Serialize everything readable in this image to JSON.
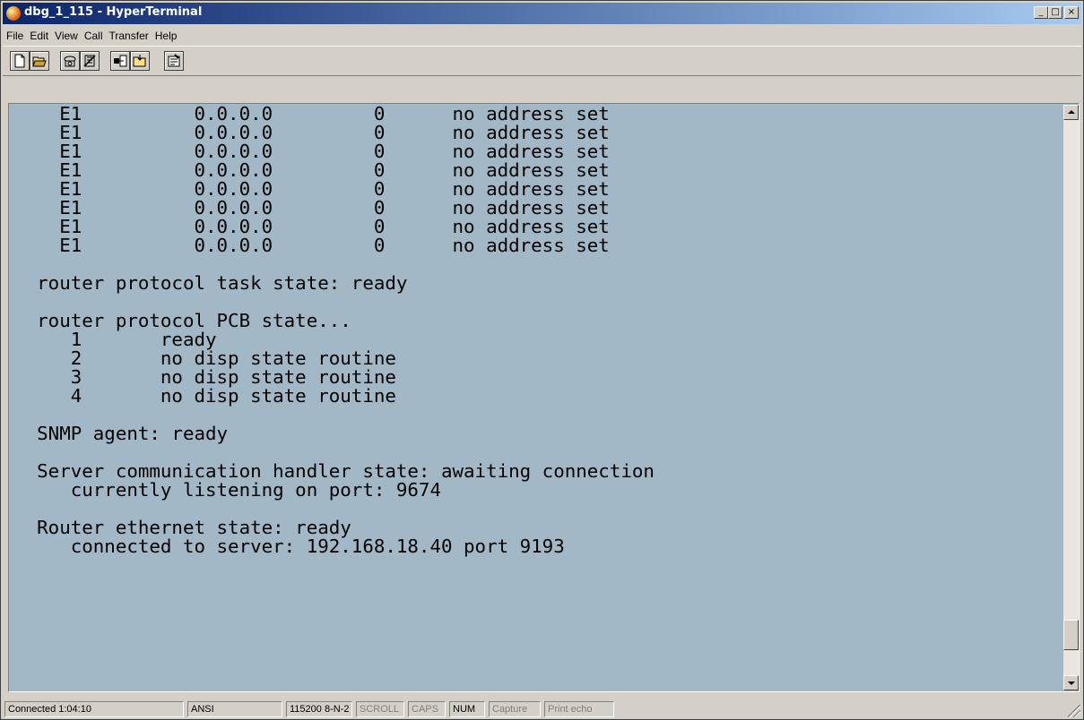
{
  "window": {
    "title": "dbg_1_115 - HyperTerminal",
    "controls": {
      "minimize": "_",
      "maximize": "□",
      "close": "×"
    }
  },
  "menu": [
    "File",
    "Edit",
    "View",
    "Call",
    "Transfer",
    "Help"
  ],
  "toolbar": {
    "buttons": [
      "new-icon",
      "open-icon",
      "connect-icon",
      "disconnect-icon",
      "send-icon",
      "receive-icon",
      "properties-icon"
    ]
  },
  "terminal": {
    "lines": [
      "  E1          0.0.0.0         0      no address set",
      "  E1          0.0.0.0         0      no address set",
      "  E1          0.0.0.0         0      no address set",
      "  E1          0.0.0.0         0      no address set",
      "  E1          0.0.0.0         0      no address set",
      "  E1          0.0.0.0         0      no address set",
      "  E1          0.0.0.0         0      no address set",
      "  E1          0.0.0.0         0      no address set",
      "",
      "router protocol task state: ready",
      "",
      "router protocol PCB state...",
      "   1       ready",
      "   2       no disp state routine",
      "   3       no disp state routine",
      "   4       no disp state routine",
      "",
      "SNMP agent: ready",
      "",
      "Server communication handler state: awaiting connection",
      "   currently listening on port: 9674",
      "",
      "Router ethernet state: ready",
      "   connected to server: 192.168.18.40 port 9193"
    ]
  },
  "status": {
    "connection": "Connected 1:04:10",
    "emulation": "ANSI",
    "port_settings": "115200 8-N-2",
    "scroll": "SCROLL",
    "caps": "CAPS",
    "num": "NUM",
    "capture": "Capture",
    "print_echo": "Print echo"
  }
}
